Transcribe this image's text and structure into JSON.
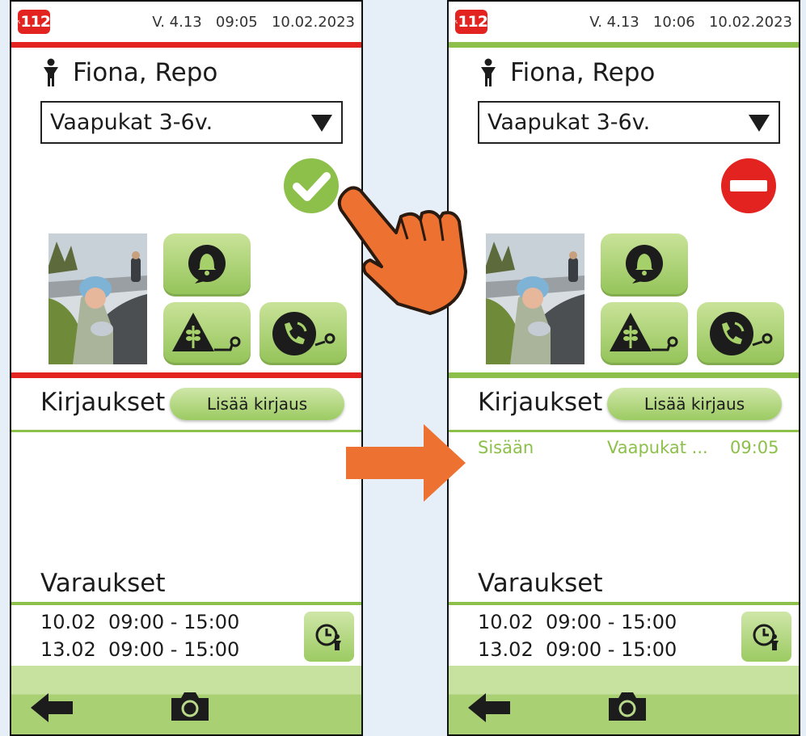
{
  "phones": [
    {
      "status": {
        "badge": "112",
        "version": "V. 4.13",
        "time": "09:05",
        "date": "10.02.2023",
        "bar_color": "#e3231f"
      },
      "child": {
        "name": "Fiona, Repo",
        "icon": "child-icon"
      },
      "group_select": {
        "value": "Vaapukat 3-6v.",
        "icon": "dropdown-triangle-icon"
      },
      "presence": {
        "state": "absent",
        "icon": "check-circle-icon",
        "color": "#8dc04a"
      },
      "tiles": [
        "bell-notification-icon",
        "allergy-wheat-icon",
        "phone-call-icon"
      ],
      "section_color": "#e3231f",
      "kirjaukset": {
        "title": "Kirjaukset",
        "add_label": "Lisää kirjaus",
        "entries": []
      },
      "varaukset": {
        "title": "Varaukset",
        "items": [
          {
            "date": "10.02",
            "time": "09:00 - 15:00"
          },
          {
            "date": "13.02",
            "time": "09:00 - 15:00"
          }
        ],
        "button_icon": "clock-child-icon"
      },
      "bottom": {
        "back_icon": "back-arrow-icon",
        "camera_icon": "camera-icon"
      }
    },
    {
      "status": {
        "badge": "112",
        "version": "V. 4.13",
        "time": "10:06",
        "date": "10.02.2023",
        "bar_color": "#8dc04a"
      },
      "child": {
        "name": "Fiona, Repo",
        "icon": "child-icon"
      },
      "group_select": {
        "value": "Vaapukat 3-6v.",
        "icon": "dropdown-triangle-icon"
      },
      "presence": {
        "state": "present",
        "icon": "no-entry-icon",
        "color": "#e3231f"
      },
      "tiles": [
        "bell-notification-icon",
        "allergy-wheat-icon",
        "phone-call-icon"
      ],
      "section_color": "#8dc04a",
      "kirjaukset": {
        "title": "Kirjaukset",
        "add_label": "Lisää kirjaus",
        "entries": [
          {
            "type": "Sisään",
            "group": "Vaapukat ...",
            "time": "09:05"
          }
        ]
      },
      "varaukset": {
        "title": "Varaukset",
        "items": [
          {
            "date": "10.02",
            "time": "09:00 - 15:00"
          },
          {
            "date": "13.02",
            "time": "09:00 - 15:00"
          }
        ],
        "button_icon": "clock-child-icon"
      },
      "bottom": {
        "back_icon": "back-arrow-icon",
        "camera_icon": "camera-icon"
      }
    }
  ],
  "overlays": {
    "tap_hand_icon": "pointing-hand-icon",
    "arrow_icon": "right-arrow-icon",
    "accent_color": "#ed7131"
  }
}
